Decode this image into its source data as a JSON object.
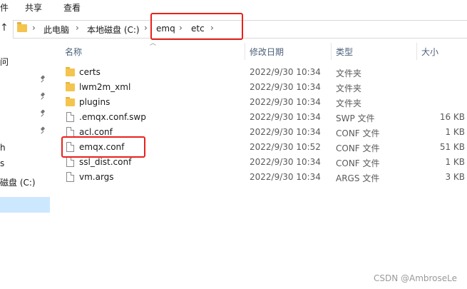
{
  "ribbon": {
    "tabs": [
      "件",
      "共享",
      "查看"
    ]
  },
  "address": {
    "up_arrow": "↑",
    "crumbs": [
      "此电脑",
      "本地磁盘 (C:)",
      "emq",
      "etc"
    ],
    "separator": "›"
  },
  "left_pane": {
    "items": [
      "问",
      "h",
      "s",
      "磁盘 (C:)"
    ]
  },
  "columns": {
    "name": "名称",
    "date": "修改日期",
    "type": "类型",
    "size": "大小"
  },
  "files": [
    {
      "name": "certs",
      "date": "2022/9/30 10:34",
      "type": "文件夹",
      "size": "",
      "icon": "folder-icon"
    },
    {
      "name": "lwm2m_xml",
      "date": "2022/9/30 10:34",
      "type": "文件夹",
      "size": "",
      "icon": "folder-icon"
    },
    {
      "name": "plugins",
      "date": "2022/9/30 10:34",
      "type": "文件夹",
      "size": "",
      "icon": "folder-icon"
    },
    {
      "name": ".emqx.conf.swp",
      "date": "2022/9/30 10:34",
      "type": "SWP 文件",
      "size": "16 KB",
      "icon": "file-icon"
    },
    {
      "name": "acl.conf",
      "date": "2022/9/30 10:34",
      "type": "CONF 文件",
      "size": "1 KB",
      "icon": "file-icon"
    },
    {
      "name": "emqx.conf",
      "date": "2022/9/30 10:52",
      "type": "CONF 文件",
      "size": "51 KB",
      "icon": "file-icon"
    },
    {
      "name": "ssl_dist.conf",
      "date": "2022/9/30 10:34",
      "type": "CONF 文件",
      "size": "1 KB",
      "icon": "file-icon"
    },
    {
      "name": "vm.args",
      "date": "2022/9/30 10:34",
      "type": "ARGS 文件",
      "size": "3 KB",
      "icon": "file-icon"
    }
  ],
  "watermark": "CSDN @AmbroseLe",
  "colors": {
    "highlight": "#e8221b",
    "folder": "#f3c44e",
    "selection": "#cce8ff"
  }
}
